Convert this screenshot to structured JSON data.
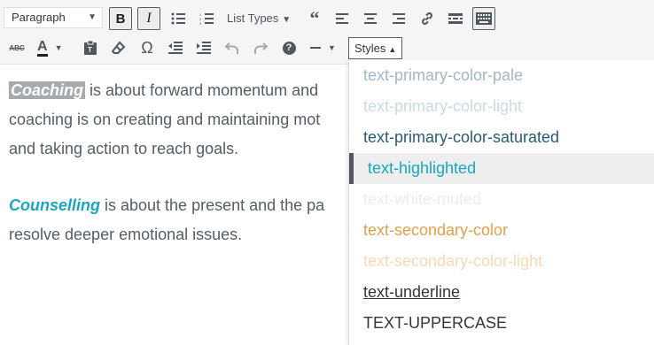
{
  "toolbar": {
    "format_select": {
      "value": "Paragraph"
    },
    "list_types_label": "List Types",
    "styles_label": "Styles",
    "buttons": {
      "bold": "B",
      "italic": "I",
      "omega": "Ω",
      "help": "?"
    },
    "colors": {
      "active_border": "#555d66",
      "icon": "#50575e",
      "text_color_underline": "#1e1e1e"
    }
  },
  "content": {
    "p1": {
      "strong": "Coaching",
      "text_line1": " is about forward momentum and",
      "text_line2": "coaching is on creating and maintaining mot",
      "text_line3": "and taking action to reach goals."
    },
    "p2": {
      "strong": "Counselling",
      "text_line1": " is about the present and the pa",
      "text_line2": "resolve deeper emotional issues."
    }
  },
  "styles_menu": {
    "items": [
      {
        "label": "text-primary-color-pale",
        "color": "#a2b7c2"
      },
      {
        "label": "text-primary-color-light",
        "color": "#c9dae4"
      },
      {
        "label": "text-primary-color-saturated",
        "color": "#2b5a77"
      },
      {
        "label": "text-highlighted",
        "color": "#1aa6bf",
        "selected": true
      },
      {
        "label": "text-white-muted",
        "color": "#e8eef0"
      },
      {
        "label": "text-secondary-color",
        "color": "#e0a04e"
      },
      {
        "label": "text-secondary-color-light",
        "color": "#f5d9b5"
      },
      {
        "label": "text-underline",
        "color": "#32373c",
        "underline": true
      },
      {
        "label": "TEXT-UPPERCASE",
        "color": "#32373c"
      }
    ]
  }
}
